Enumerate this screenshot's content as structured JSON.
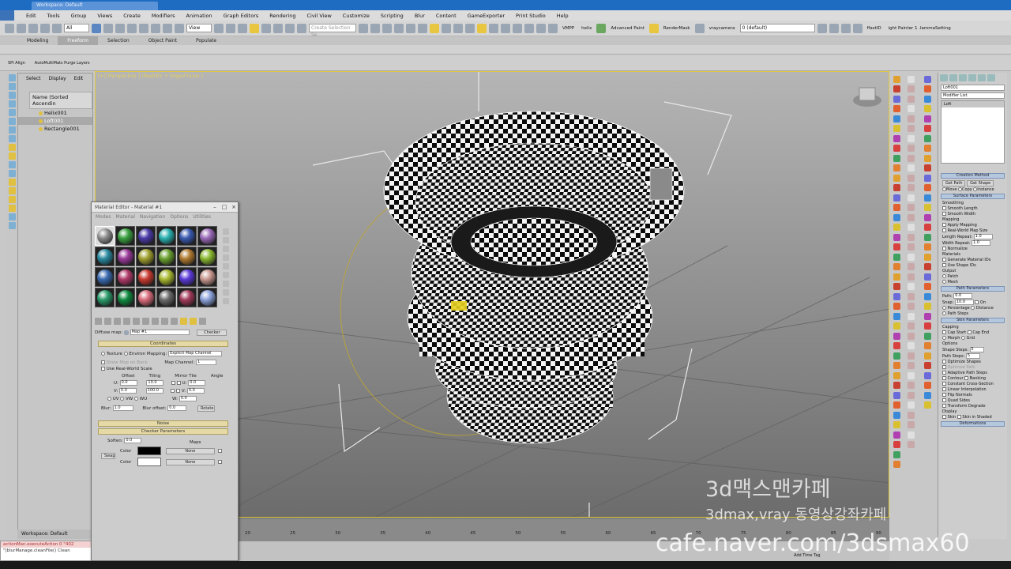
{
  "title_bar": {
    "tabs": [
      "Workspace: Default",
      ""
    ],
    "right_text": ""
  },
  "menu": [
    "Edit",
    "Tools",
    "Group",
    "Views",
    "Create",
    "Modifiers",
    "Animation",
    "Graph Editors",
    "Rendering",
    "Civil View",
    "Customize",
    "Scripting",
    "Blur",
    "Content",
    "GameExporter",
    "Print Studio",
    "Help"
  ],
  "toolbar": {
    "filter_value": "All",
    "ref_coord": "View",
    "selection_set_placeholder": "Create Selection Se",
    "layer_value": "0 (default)",
    "texts": [
      "VMPP",
      "helix",
      "Advanced Paint",
      "RenderMask",
      "vraycamera",
      "ffastID",
      "ight Painter 1 .lammaSetting"
    ]
  },
  "ribbon_tabs": [
    "Modeling",
    "Freeform",
    "Selection",
    "Object Paint",
    "Populate"
  ],
  "ribbon_active": "Freeform",
  "subtool": [
    "SPI Align",
    "AutoMultiMats Purge Layers"
  ],
  "explorer": {
    "tabs": [
      "Select",
      "Display",
      "Edit"
    ],
    "header": "Name (Sorted Ascendin",
    "rows": [
      "Helix001",
      "Loft001",
      "Rectangle001"
    ],
    "selected": "Loft001"
  },
  "workspace_label": "Workspace: Default",
  "maxscript": {
    "line1": "actionMan.executeAction 0 \"402",
    "line2": "\"[blurManage.cleanFile() Clean"
  },
  "viewport": {
    "label": "[+] [Perspective ] [Realistic + Edged Faces ]"
  },
  "material_editor": {
    "title": "Material Editor - Material #1",
    "menu": [
      "Modes",
      "Material",
      "Navigation",
      "Options",
      "Utilities"
    ],
    "slot_colors": [
      "#8a8a8a",
      "#3aa040",
      "#4a3aa8",
      "#2ab0b0",
      "#3a5ab0",
      "#9a6ab8",
      "#2a8aa0",
      "#9a3a9a",
      "#a0a030",
      "#6aa030",
      "#b07a30",
      "#8ab830",
      "#3a6ab0",
      "#b03a6a",
      "#c83a30",
      "#a8b830",
      "#5a3ad8",
      "#c89890",
      "#2a9a6a",
      "#108a40",
      "#d86a7a",
      "#6a6a6a",
      "#a03a5a",
      "#8aa0d8"
    ],
    "map_label": "Diffuse map:",
    "map_name": "Map #1",
    "map_type": "Checker",
    "coordinates_header": "Coordinates",
    "texture_label": "Texture",
    "environ_label": "Environ",
    "mapping_label": "Mapping:",
    "mapping_value": "Explicit Map Channel",
    "show_map_label": "Show Map on Back",
    "map_channel_label": "Map Channel:",
    "map_channel_value": "1",
    "real_world_label": "Use Real-World Scale",
    "col_headers": [
      "Offset",
      "Tiling",
      "Mirror Tile",
      "Angle"
    ],
    "u_offset": "0.0",
    "v_offset": "0.0",
    "u_tiling": "10.0",
    "v_tiling": "100.0",
    "u_angle": "0.0",
    "v_angle": "0.0",
    "w_angle": "0.0",
    "uv_labels": [
      "UV",
      "VW",
      "WU"
    ],
    "blur_label": "Blur:",
    "blur_value": "1.0",
    "blur_offset_label": "Blur offset:",
    "blur_offset_value": "0.0",
    "rotate_label": "Rotate",
    "noise_header": "Noise",
    "checker_header": "Checker Parameters",
    "soften_label": "Soften:",
    "soften_value": "0.0",
    "maps_label": "Maps",
    "swap_label": "Swap",
    "color_label": "Color",
    "none_label": "None",
    "color1": "#000000",
    "color2": "#ffffff"
  },
  "cmd_panel": {
    "object_name": "Loft001",
    "modifier_list": "Modifier List",
    "stack_item": "Loft",
    "creation_method": "Creation Method",
    "get_path": "Get Path",
    "get_shape": "Get Shape",
    "move": "Move",
    "copy": "Copy",
    "instance": "Instance",
    "surface_params": "Surface Parameters",
    "smoothing": "Smoothing",
    "smooth_length": "Smooth Length",
    "smooth_width": "Smooth Width",
    "mapping": "Mapping",
    "apply_mapping": "Apply Mapping",
    "real_world": "Real-World Map Size",
    "length_repeat": "Length Repeat:",
    "length_repeat_value": "1.0",
    "width_repeat": "Width Repeat:",
    "width_repeat_value": "1.0",
    "normalize": "Normalize",
    "materials": "Materials",
    "gen_mat_ids": "Generate Material IDs",
    "use_shape_ids": "Use Shape IDs",
    "output": "Output",
    "patch": "Patch",
    "mesh": "Mesh",
    "path_params": "Path Parameters",
    "path_label": "Path:",
    "path_value": "0.0",
    "snap_label": "Snap:",
    "snap_value": "10.0",
    "on_label": "On",
    "percentage": "Percentage",
    "distance": "Distance",
    "path_steps": "Path Steps",
    "skin_params": "Skin Parameters",
    "capping": "Capping",
    "cap_start": "Cap Start",
    "cap_end": "Cap End",
    "morph": "Morph",
    "grid": "Grid",
    "options": "Options",
    "shape_steps": "Shape Steps:",
    "shape_steps_value": "5",
    "path_steps2": "Path Steps:",
    "path_steps_value": "5",
    "optimize_shapes": "Optimize Shapes",
    "optimize_path": "Optimize Path",
    "adaptive_path": "Adaptive Path Steps",
    "contour": "Contour",
    "banking": "Banking",
    "constant_cross": "Constant Cross-Section",
    "linear_interp": "Linear Interpolation",
    "flip_normals": "Flip Normals",
    "quad_sides": "Quad Sides",
    "transform_degrade": "Transform Degrade",
    "display": "Display",
    "skin": "Skin",
    "skin_in_shaded": "Skin in Shaded",
    "deformations": "Deformations"
  },
  "timeline": {
    "ticks": [
      "20",
      "25",
      "30",
      "35",
      "40",
      "45",
      "50",
      "55",
      "60",
      "65",
      "70",
      "75",
      "80",
      "85",
      "90"
    ],
    "add_time_tag": "Add Time Tag"
  },
  "watermark": {
    "line1": "3d맥스맨카페",
    "line2": "3dmax,vray 동영상강좌카페",
    "line3": "cafe.naver.com/3dsmax60"
  }
}
